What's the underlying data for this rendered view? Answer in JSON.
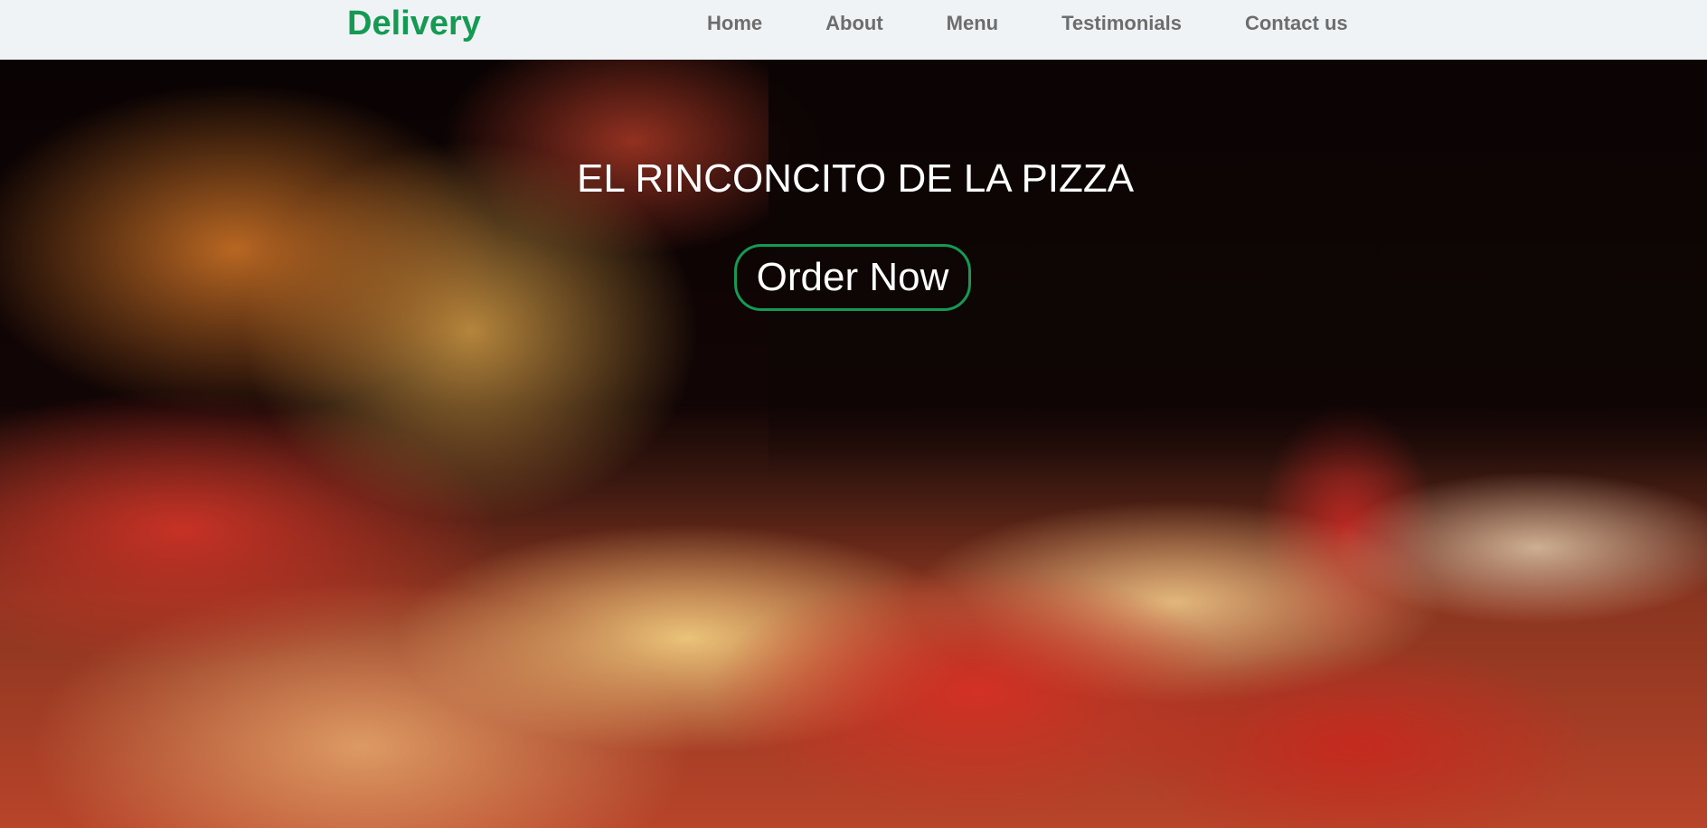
{
  "navbar": {
    "brand": "Delivery",
    "links": [
      {
        "label": "Home"
      },
      {
        "label": "About"
      },
      {
        "label": "Menu"
      },
      {
        "label": "Testimonials"
      },
      {
        "label": "Contact us"
      }
    ]
  },
  "hero": {
    "title": "EL RINCONCITO DE LA PIZZA",
    "cta_label": "Order Now",
    "background": "pizza-photo"
  },
  "colors": {
    "accent": "#149a52",
    "nav_bg": "#f0f3f6",
    "nav_text": "#6d6d6d",
    "hero_text": "#ffffff"
  }
}
